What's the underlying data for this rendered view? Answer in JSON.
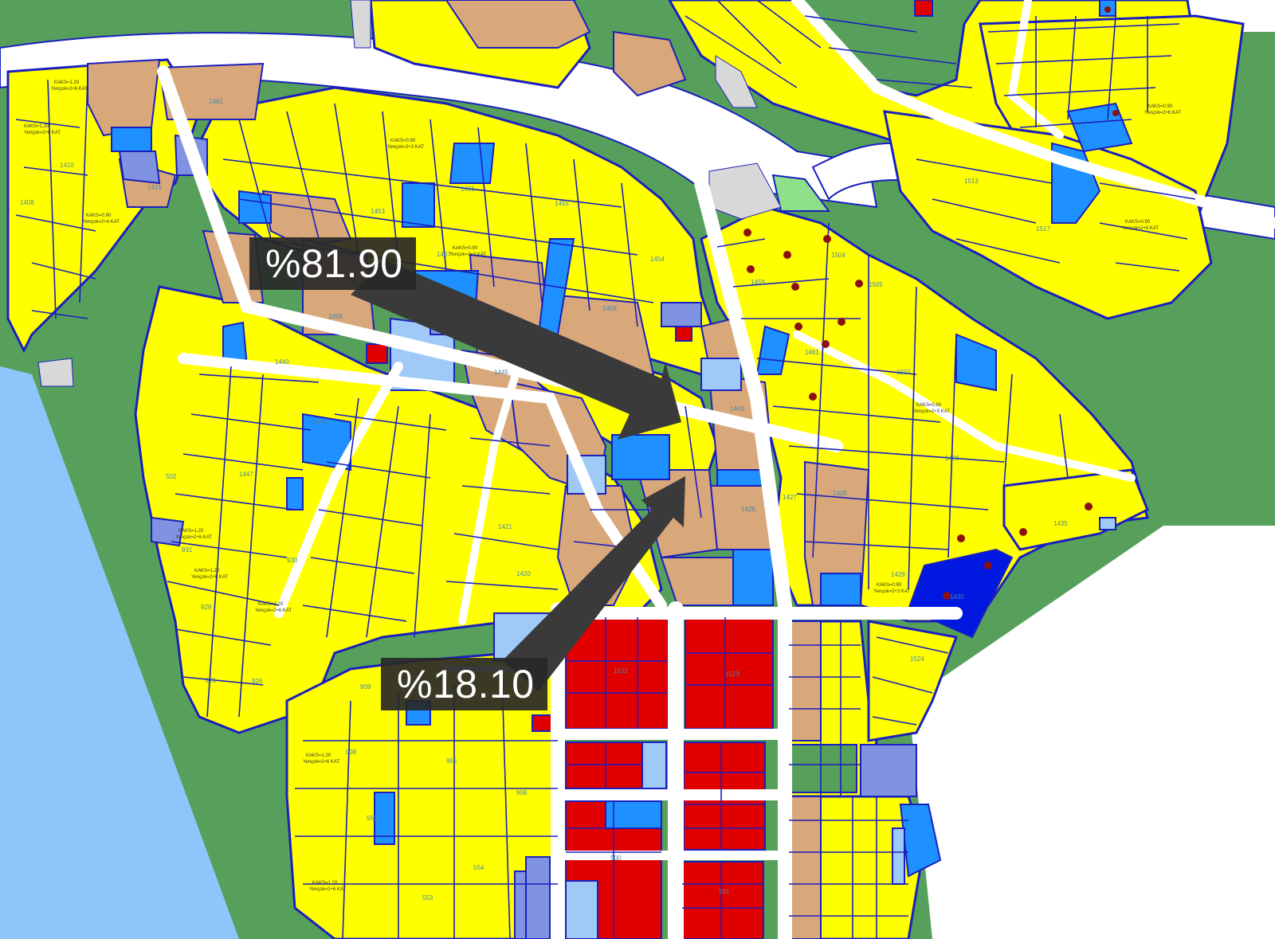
{
  "colors": {
    "residential": "#ffff00",
    "mixed_use": "#d8a77a",
    "commercial": "#e00000",
    "public_service": "#1e90ff",
    "light_blue": "#9fcaf7",
    "periwinkle": "#7f93e0",
    "deep_blue": "#0018e0",
    "park_green": "#57a05c",
    "light_green": "#8fe08a",
    "water": "#8ec5fa",
    "road": "#ffffff",
    "gray_area": "#d8d8d8",
    "parcel_outline": "#1a1fbf"
  },
  "annotations": {
    "share_a": "%81.90",
    "share_b": "%18.10"
  },
  "parcel_labels": [
    "1410",
    "1408",
    "1461",
    "1415",
    "1453",
    "1467",
    "1466",
    "1456",
    "1454",
    "1455",
    "1458",
    "1440",
    "1443",
    "1449",
    "1447",
    "1445",
    "1421",
    "1420",
    "1426",
    "1427",
    "1425",
    "1422",
    "1459",
    "1461",
    "1504",
    "1505",
    "1507",
    "1513",
    "1517",
    "1429",
    "1430",
    "1435",
    "1436",
    "1522",
    "1523",
    "1524",
    "931",
    "930",
    "929",
    "926",
    "921",
    "908",
    "909",
    "906",
    "905",
    "552",
    "554",
    "553",
    "502",
    "500",
    "501"
  ],
  "zoning_texts": [
    "KAKS=1.20",
    "KAKS=0.90",
    "KAKS=0.60",
    "Yençok=2+6 KAT",
    "Yençok=2+4 KAT",
    "Yençok=2+3 KAT"
  ]
}
